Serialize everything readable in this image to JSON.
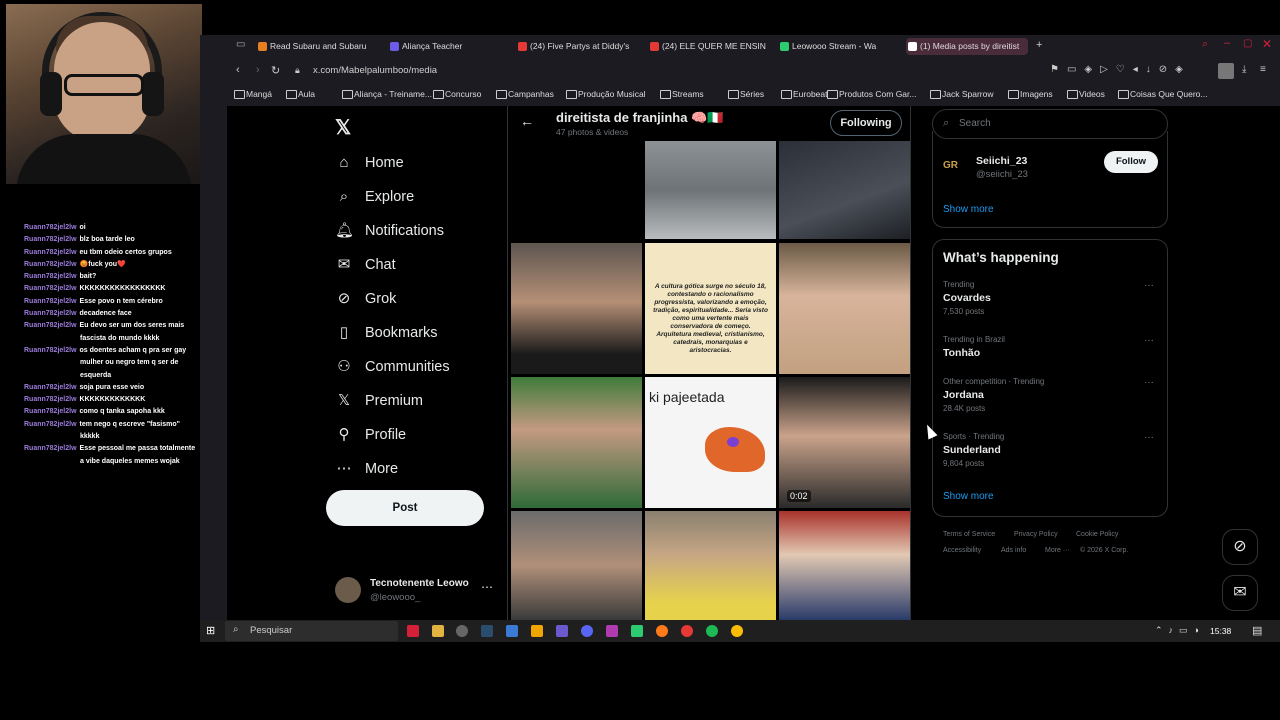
{
  "chat": {
    "user": "Ruann782jel2lw",
    "lines": [
      {
        "user": "Ruann782jel2lw",
        "msg": "oi"
      },
      {
        "user": "Ruann782jel2lw",
        "msg": "blz boa tarde leo"
      },
      {
        "user": "Ruann782jel2lw",
        "msg": "eu tbm odeio certos grupos"
      },
      {
        "user": "Ruann782jel2lw",
        "msg": "😡fuck you❤️"
      },
      {
        "user": "Ruann782jel2lw",
        "msg": "bait?"
      },
      {
        "user": "Ruann782jel2lw",
        "msg": "KKKKKKKKKKKKKKKKK"
      },
      {
        "user": "Ruann782jel2lw",
        "msg": "Esse povo n tem cérebro"
      },
      {
        "user": "Ruann782jel2lw",
        "msg": "decadence face"
      },
      {
        "user": "Ruann782jel2lw",
        "msg": "Eu devo ser um dos seres mais"
      },
      {
        "user": "",
        "msg": "fascista do mundo kkkk"
      },
      {
        "user": "Ruann782jel2lw",
        "msg": "os doentes acham q pra ser gay"
      },
      {
        "user": "",
        "msg": "mulher ou negro tem q ser de"
      },
      {
        "user": "",
        "msg": "esquerda"
      },
      {
        "user": "Ruann782jel2lw",
        "msg": "soja pura esse veio"
      },
      {
        "user": "Ruann782jel2lw",
        "msg": "KKKKKKKKKKKKK"
      },
      {
        "user": "Ruann782jel2lw",
        "msg": "como q tanka sapoha kkk"
      },
      {
        "user": "Ruann782jel2lw",
        "msg": "tem nego q escreve \"fasismo\""
      },
      {
        "user": "",
        "msg": "kkkkk"
      },
      {
        "user": "Ruann782jel2lw",
        "msg": "Esse pessoal me passa totalmente"
      },
      {
        "user": "",
        "msg": "a vibe daqueles memes wojak"
      }
    ]
  },
  "browser": {
    "tabs": [
      {
        "label": "Read Subaru and Subaru",
        "color": "#e67e22"
      },
      {
        "label": "Aliança Teacher",
        "color": "#6c5ce7"
      },
      {
        "label": "(24) Five Partys at Diddy's",
        "color": "#e53935"
      },
      {
        "label": "(24) ELE QUER ME ENSIN",
        "color": "#e53935"
      },
      {
        "label": "Leowooo Stream - Wa",
        "color": "#2ecc71"
      },
      {
        "label": "(1) Media posts by direitist",
        "color": "#ffffff"
      }
    ],
    "new_tab": "+",
    "url": "x.com/Mabelpalumboo/media",
    "bookmarks": [
      "Mangá",
      "Aula",
      "Aliança - Treiname...",
      "Concurso",
      "Campanhas",
      "Produção Musical",
      "Streams",
      "Séries",
      "Eurobeat",
      "Produtos Com Gar...",
      "Jack Sparrow",
      "Imagens",
      "Videos",
      "Coisas Que Quero..."
    ]
  },
  "nav": {
    "items": [
      {
        "label": "Home",
        "icon": "home-icon",
        "glyph": "⌂"
      },
      {
        "label": "Explore",
        "icon": "search-icon",
        "glyph": "⌕"
      },
      {
        "label": "Notifications",
        "icon": "bell-icon",
        "glyph": "🔔︎"
      },
      {
        "label": "Chat",
        "icon": "mail-icon",
        "glyph": "✉"
      },
      {
        "label": "Grok",
        "icon": "grok-icon",
        "glyph": "⊘"
      },
      {
        "label": "Bookmarks",
        "icon": "bookmark-icon",
        "glyph": "▯"
      },
      {
        "label": "Communities",
        "icon": "people-icon",
        "glyph": "⚇"
      },
      {
        "label": "Premium",
        "icon": "x-icon",
        "glyph": "𝕏"
      },
      {
        "label": "Profile",
        "icon": "person-icon",
        "glyph": "⚲"
      },
      {
        "label": "More",
        "icon": "more-circle-icon",
        "glyph": "⋯"
      }
    ],
    "post_label": "Post",
    "account": {
      "name": "Tecnotenente Leowo",
      "handle": "@leowooo_"
    }
  },
  "profile": {
    "name": "direitista de franjinha 🧠🇮🇹",
    "subtitle": "47 photos & videos",
    "following_label": "Following"
  },
  "media": {
    "video_duration": "0:02",
    "meme_caption": "ki pajeetada",
    "quote_text": "A cultura gótica surge no século 18, contestando o racionalismo progressista, valorizando a emoção, tradição, espiritualidade... Seria visto como uma vertente mais conservadora de começo. Arquitetura medieval, cristianismo, catedrais, monarquias e aristocracias."
  },
  "right": {
    "search_placeholder": "Search",
    "who": {
      "name": "Seiichi_23",
      "handle": "@seiichi_23",
      "logo": "GR",
      "follow_label": "Follow",
      "show_more": "Show more"
    },
    "happening": {
      "title": "What’s happening",
      "trends": [
        {
          "context": "Trending",
          "title": "Covardes",
          "posts": "7,530 posts"
        },
        {
          "context": "Trending in Brazil",
          "title": "Tonhão",
          "posts": ""
        },
        {
          "context": "Other competition · Trending",
          "title": "Jordana",
          "posts": "28.4K posts"
        },
        {
          "context": "Sports · Trending",
          "title": "Sunderland",
          "posts": "9,804 posts"
        }
      ],
      "show_more": "Show more"
    },
    "footer": [
      "Terms of Service",
      "Privacy Policy",
      "Cookie Policy",
      "Accessibility",
      "Ads info",
      "More ···",
      "© 2026 X Corp."
    ]
  },
  "taskbar": {
    "search_label": "Pesquisar",
    "time": "15:38"
  }
}
